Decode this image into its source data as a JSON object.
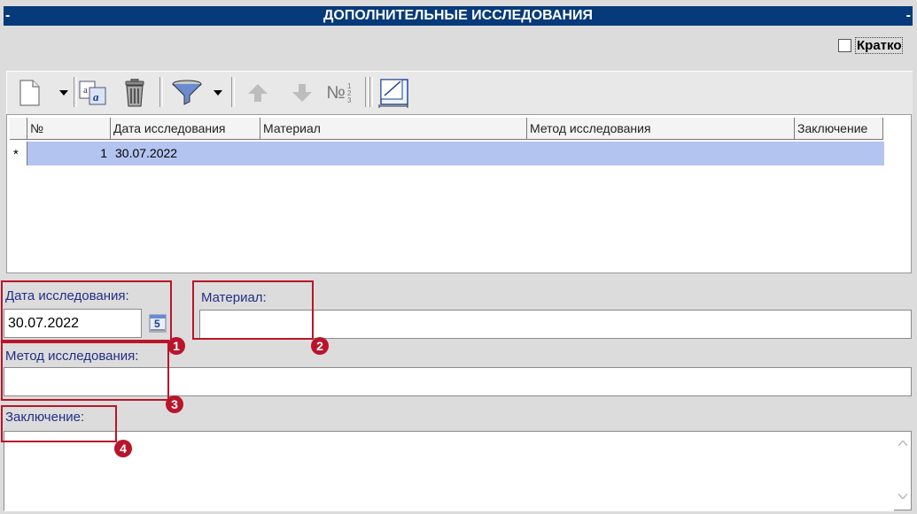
{
  "title_bar": {
    "title": "ДОПОЛНИТЕЛЬНЫЕ ИССЛЕДОВАНИЯ",
    "left_mark": "-",
    "right_mark": "-"
  },
  "brief_checkbox": {
    "label": "Кратко",
    "checked": false
  },
  "toolbar": {
    "buttons": [
      {
        "icon": "new-document-icon"
      },
      {
        "icon": "dropdown-arrow-icon"
      },
      {
        "icon": "copy-text-icon"
      },
      {
        "icon": "trash-icon"
      },
      {
        "icon": "filter-icon"
      },
      {
        "icon": "dropdown-arrow-icon"
      },
      {
        "icon": "arrow-up-icon"
      },
      {
        "icon": "arrow-down-icon"
      },
      {
        "icon": "numbering-icon"
      },
      {
        "icon": "resize-icon"
      }
    ],
    "numbering_glyph": "№"
  },
  "grid": {
    "columns": [
      "№",
      "Дата исследования",
      "Материал",
      "Метод исследования",
      "Заключение"
    ],
    "rows": [
      {
        "marker": "*",
        "num": "1",
        "date": "30.07.2022",
        "material": "",
        "method": "",
        "conclusion": ""
      }
    ]
  },
  "form": {
    "date": {
      "label": "Дата исследования:",
      "value": "30.07.2022",
      "calendar_glyph": "5"
    },
    "material": {
      "label": "Материал:",
      "value": ""
    },
    "method": {
      "label": "Метод исследования:",
      "value": ""
    },
    "conclusion": {
      "label": "Заключение:",
      "value": ""
    }
  },
  "annotations": [
    "1",
    "2",
    "3",
    "4"
  ],
  "colors": {
    "title_bg": "#063a7a",
    "label_text": "#242e86",
    "selected_row": "#b4c4f1",
    "annotation_red": "#b9152a"
  }
}
